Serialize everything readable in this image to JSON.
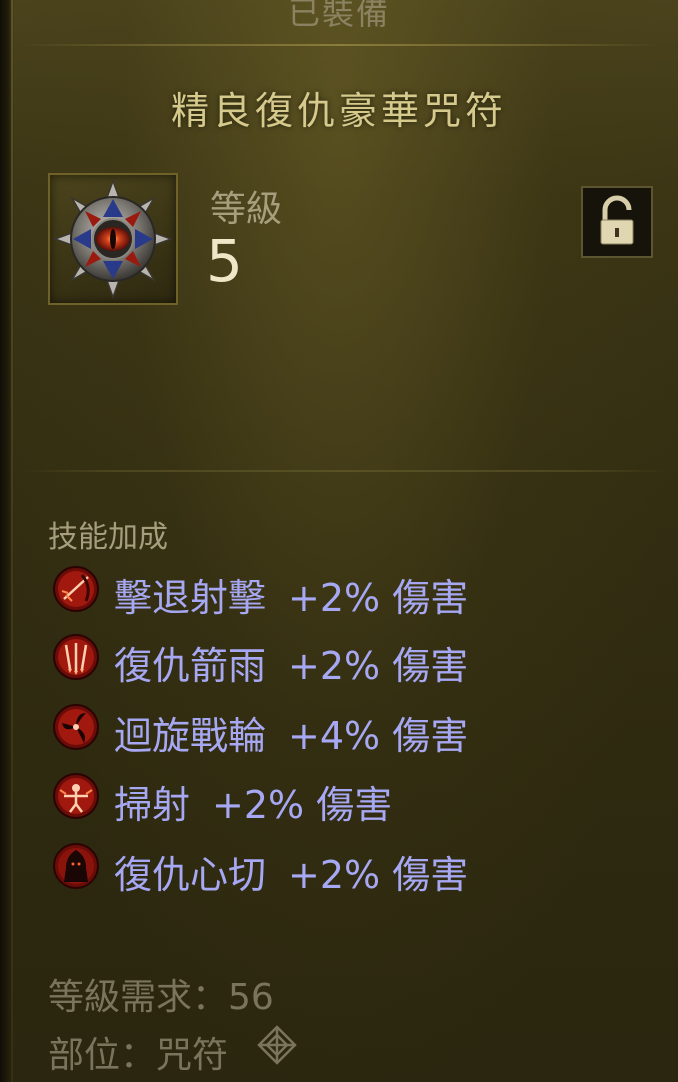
{
  "header": {
    "equipped_label": "已裝備",
    "item_name": "精良復仇豪華咒符"
  },
  "item": {
    "level_label": "等級",
    "level_value": "5",
    "icon": "amulet-eye-icon",
    "lock_icon": "unlock-icon"
  },
  "skill_bonuses": {
    "header": "技能加成",
    "items": [
      {
        "name": "擊退射擊",
        "bonus": "+2% 傷害",
        "icon": "bow-shot-icon"
      },
      {
        "name": "復仇箭雨",
        "bonus": "+2% 傷害",
        "icon": "arrow-rain-icon"
      },
      {
        "name": "迴旋戰輪",
        "bonus": "+4% 傷害",
        "icon": "whirling-blade-icon"
      },
      {
        "name": "掃射",
        "bonus": "+2% 傷害",
        "icon": "strafe-icon"
      },
      {
        "name": "復仇心切",
        "bonus": "+2% 傷害",
        "icon": "vengeance-icon"
      }
    ]
  },
  "footer": {
    "level_requirement": "等級需求：56",
    "slot": "部位：咒符",
    "slot_icon": "amulet-slot-icon"
  },
  "colors": {
    "skill_text": "#a7a8f4",
    "item_name": "#d6c98c",
    "muted": "#7a745c"
  }
}
